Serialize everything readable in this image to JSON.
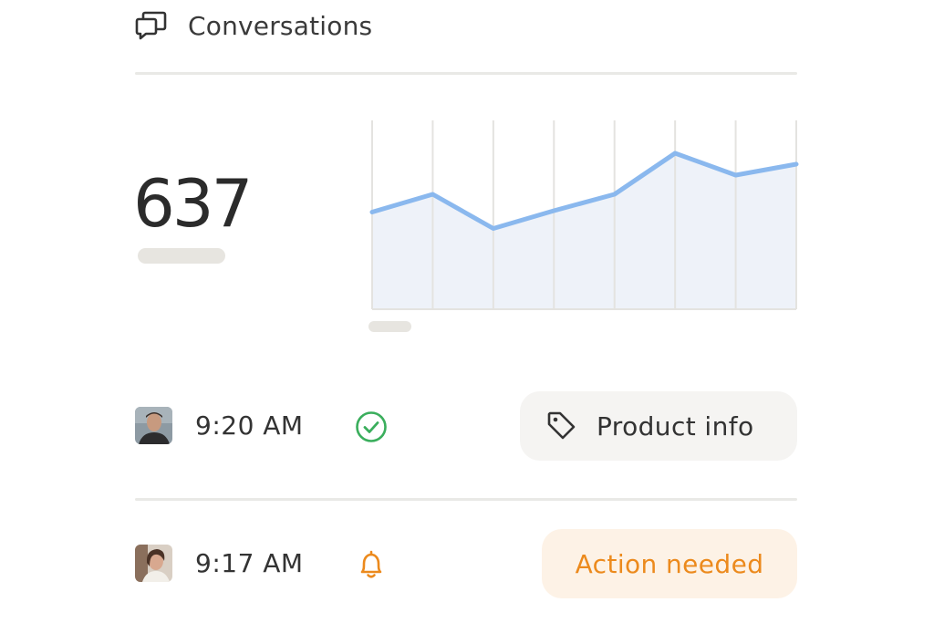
{
  "header": {
    "title": "Conversations",
    "icon": "conversations-icon"
  },
  "metric": {
    "value": "637"
  },
  "chart_data": {
    "type": "area",
    "x": [
      1,
      2,
      3,
      4,
      5,
      6,
      7,
      8
    ],
    "series": [
      {
        "values": [
          45,
          58,
          33,
          46,
          58,
          88,
          72,
          80
        ]
      }
    ],
    "ylim": [
      0,
      100
    ],
    "grid": "vertical",
    "line_color": "#8ab8ee",
    "fill_color": "#eef2f9",
    "title": "",
    "xlabel": "",
    "ylabel": ""
  },
  "conversations": [
    {
      "time": "9:20 AM",
      "status_icon": "check-circle-icon",
      "status_color": "#3aae5c",
      "tag": {
        "label": "Product info",
        "icon": "tag-icon",
        "style": "neutral"
      }
    },
    {
      "time": "9:17 AM",
      "status_icon": "bell-icon",
      "status_color": "#ec8a1d",
      "tag": {
        "label": "Action needed",
        "style": "warning"
      }
    }
  ]
}
